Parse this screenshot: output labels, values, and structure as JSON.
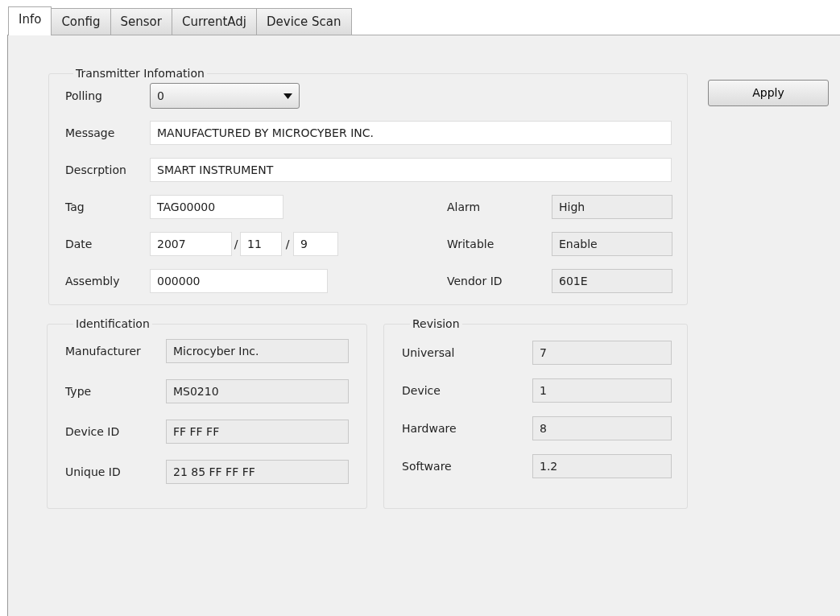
{
  "tabs": [
    {
      "label": "Info",
      "selected": true
    },
    {
      "label": "Config",
      "selected": false
    },
    {
      "label": "Sensor",
      "selected": false
    },
    {
      "label": "CurrentAdj",
      "selected": false
    },
    {
      "label": "Device Scan",
      "selected": false
    }
  ],
  "transmitter": {
    "title": "Transmitter Infomation",
    "polling": {
      "label": "Polling",
      "value": "0"
    },
    "message": {
      "label": "Message",
      "value": "MANUFACTURED BY MICROCYBER INC.",
      "editable": true
    },
    "description": {
      "label": "Descrption",
      "value": "SMART INSTRUMENT",
      "editable": true
    },
    "tag": {
      "label": "Tag",
      "value": "TAG00000",
      "editable": true
    },
    "date": {
      "label": "Date",
      "year": "2007",
      "separator_1": "/",
      "month": "11",
      "separator_2": "/",
      "day": "9",
      "editable": true
    },
    "assembly": {
      "label": "Assembly",
      "value": "000000",
      "editable": true
    },
    "alarm": {
      "label": "Alarm",
      "value": "High",
      "editable": false
    },
    "writable": {
      "label": "Writable",
      "value": "Enable",
      "editable": false
    },
    "vendor_id": {
      "label": "Vendor ID",
      "value": "601E",
      "editable": false
    }
  },
  "apply_button": "Apply",
  "identification": {
    "title": "Identification",
    "fields": [
      {
        "label": "Manufacturer",
        "value": "Microcyber Inc.",
        "editable": false
      },
      {
        "label": "Type",
        "value": "MS0210",
        "editable": false
      },
      {
        "label": "Device ID",
        "value": "FF FF FF",
        "editable": false
      },
      {
        "label": "Unique ID",
        "value": "21 85 FF FF FF",
        "editable": false
      }
    ]
  },
  "revision": {
    "title": "Revision",
    "fields": [
      {
        "label": "Universal",
        "value": "7",
        "editable": false
      },
      {
        "label": "Device",
        "value": "1",
        "editable": false
      },
      {
        "label": "Hardware",
        "value": "8",
        "editable": false
      },
      {
        "label": "Software",
        "value": "1.2",
        "editable": false
      }
    ]
  }
}
